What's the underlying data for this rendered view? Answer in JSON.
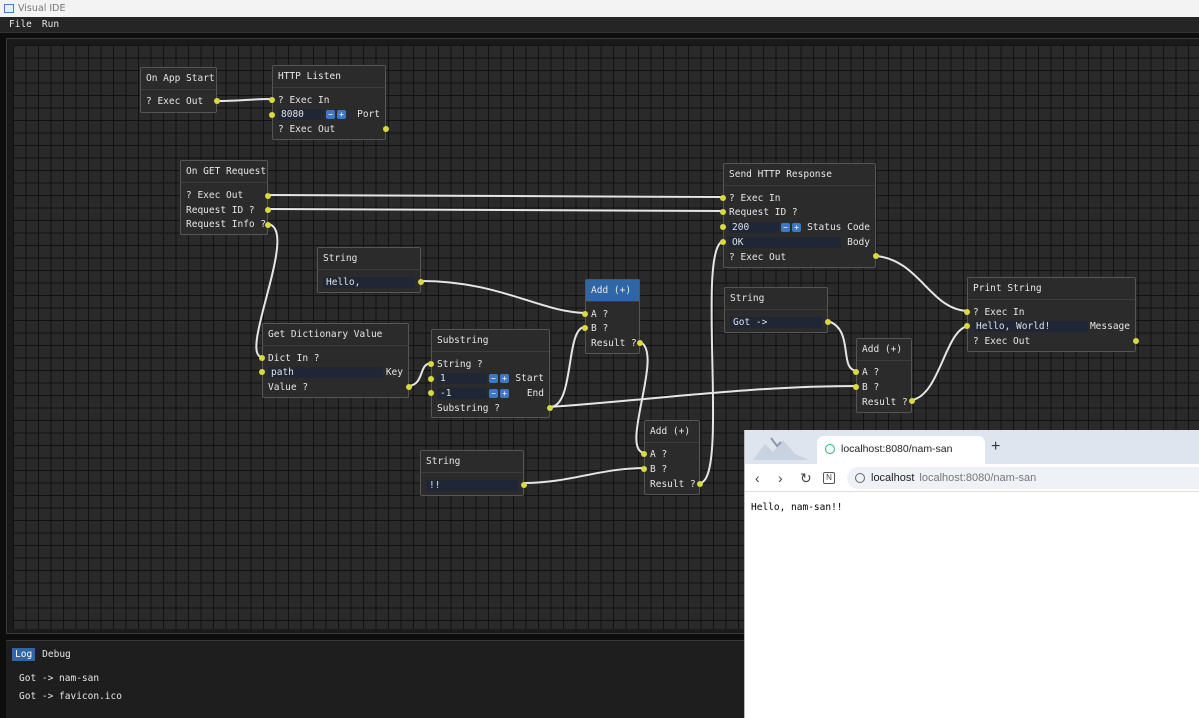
{
  "window": {
    "title": "Visual IDE"
  },
  "menu": [
    "File",
    "Run"
  ],
  "nodes": {
    "app_start": {
      "title": "On App Start",
      "exec_out": "? Exec Out"
    },
    "http_listen": {
      "title": "HTTP Listen",
      "exec_in": "? Exec In",
      "port_value": "8080",
      "port_label": "Port",
      "exec_out": "? Exec Out"
    },
    "on_get": {
      "title": "On GET Request",
      "exec_out": "? Exec Out",
      "request_id": "Request ID ?",
      "request_info": "Request Info ?"
    },
    "string1": {
      "title": "String",
      "value": "Hello,"
    },
    "get_dict": {
      "title": "Get Dictionary Value",
      "dict_in": "Dict In ?",
      "key_value": "path",
      "key_label": "Key",
      "value_out": "Value ?"
    },
    "substring": {
      "title": "Substring",
      "string_in": "String ?",
      "start_value": "1",
      "start_label": "Start",
      "end_value": "-1",
      "end_label": "End",
      "out": "Substring ?"
    },
    "add1": {
      "title": "Add (+)",
      "a": "A ?",
      "b": "B ?",
      "result": "Result ?"
    },
    "string2": {
      "title": "String",
      "value": "!!"
    },
    "add2": {
      "title": "Add (+)",
      "a": "A ?",
      "b": "B ?",
      "result": "Result ?"
    },
    "send_resp": {
      "title": "Send HTTP Response",
      "exec_in": "? Exec In",
      "request_id": "Request ID ?",
      "status_value": "200",
      "status_label": "Status Code",
      "body_value": "OK",
      "body_label": "Body",
      "exec_out": "? Exec Out"
    },
    "string3": {
      "title": "String",
      "value": "Got ->"
    },
    "add3": {
      "title": "Add (+)",
      "a": "A ?",
      "b": "B ?",
      "result": "Result ?"
    },
    "print": {
      "title": "Print String",
      "exec_in": "? Exec In",
      "msg_value": "Hello, World!",
      "msg_label": "Message",
      "exec_out": "? Exec Out"
    }
  },
  "stepper": {
    "minus": "−",
    "plus": "+"
  },
  "log": {
    "tabs": [
      "Log",
      "Debug"
    ],
    "lines": [
      "Got -> nam-san",
      "Got -> favicon.ico"
    ]
  },
  "browser": {
    "tab_title": "localhost:8080/nam-san",
    "new_tab": "+",
    "host": "localhost",
    "url": "localhost:8080/nam-san",
    "page_text": "Hello, nam-san!!",
    "icons": {
      "back": "back-arrow-icon",
      "forward": "forward-arrow-icon",
      "reload": "reload-icon",
      "reader": "reader-icon",
      "site_info": "site-info-icon"
    }
  },
  "colors": {
    "pin": "#d9d940",
    "wire": "#e6e6e6",
    "selected_header": "#2e66a6",
    "accent": "#3d78c4"
  }
}
